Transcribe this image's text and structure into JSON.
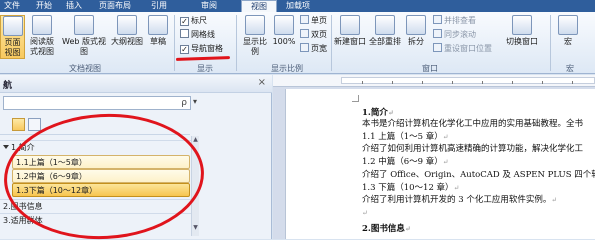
{
  "tabs": [
    "文件",
    "开始",
    "插入",
    "页面布局",
    "引用",
    "审阅",
    "视图",
    "加载项"
  ],
  "active_tab": "视图",
  "ribbon": {
    "groups": {
      "doc_views": "文档视图",
      "show": "显示",
      "zoom": "显示比例",
      "window": "窗口",
      "macros": "宏"
    },
    "doc_views": [
      "页面视图",
      "阅读版式视图",
      "Web 版式视图",
      "大纲视图",
      "草稿"
    ],
    "show_options": [
      {
        "label": "标尺",
        "checked": true
      },
      {
        "label": "网格线",
        "checked": false
      },
      {
        "label": "导航窗格",
        "checked": true
      }
    ],
    "zoom_buttons": [
      "显示比例",
      "100%"
    ],
    "page_buttons": [
      "单页",
      "双页",
      "页宽"
    ],
    "window_buttons": [
      "新建窗口",
      "全部重排",
      "拆分"
    ],
    "window_small": [
      "并排查看",
      "同步滚动",
      "重设窗口位置"
    ],
    "switch_window": "切换窗口",
    "macro_button": "宏",
    "check_mark": "✓"
  },
  "nav": {
    "title": "航",
    "close": "×",
    "search_icon": "ρ",
    "search_dropdown": "▾",
    "scroll_up": "▲",
    "scroll_down": "▼",
    "items": [
      {
        "label": "1.简介",
        "level": 1
      },
      {
        "label": "1.1上篇（1～5章）",
        "level": 2
      },
      {
        "label": "1.2中篇（6～9章）",
        "level": 2
      },
      {
        "label": "1.3下篇（10～12章）",
        "level": 2,
        "highlighted": true
      },
      {
        "label": "2.图书信息",
        "level": 1
      },
      {
        "label": "3.适用群体",
        "level": 1
      }
    ]
  },
  "document": {
    "lines": [
      {
        "text": "1.简介",
        "heading": true
      },
      {
        "text": "本书是介绍计算机在化学化工中应用的实用基础教程。全书"
      },
      {
        "text": "1.1 上篇（1～5 章）"
      },
      {
        "text": "介绍了如何利用计算机高速精确的计算功能，解决化学化工"
      },
      {
        "text": "1.2 中篇（6～9 章）"
      },
      {
        "text": "介绍了 Office、Origin、AutoCAD 及 ASPEN PLUS 四个软件"
      },
      {
        "text": "1.3 下篇（10～12 章）"
      },
      {
        "text": "介绍了利用计算机开发的 3 个化工应用软件实例。"
      },
      {
        "text": ""
      },
      {
        "text": "2.图书信息",
        "heading": true
      }
    ],
    "para_mark": "↵"
  }
}
